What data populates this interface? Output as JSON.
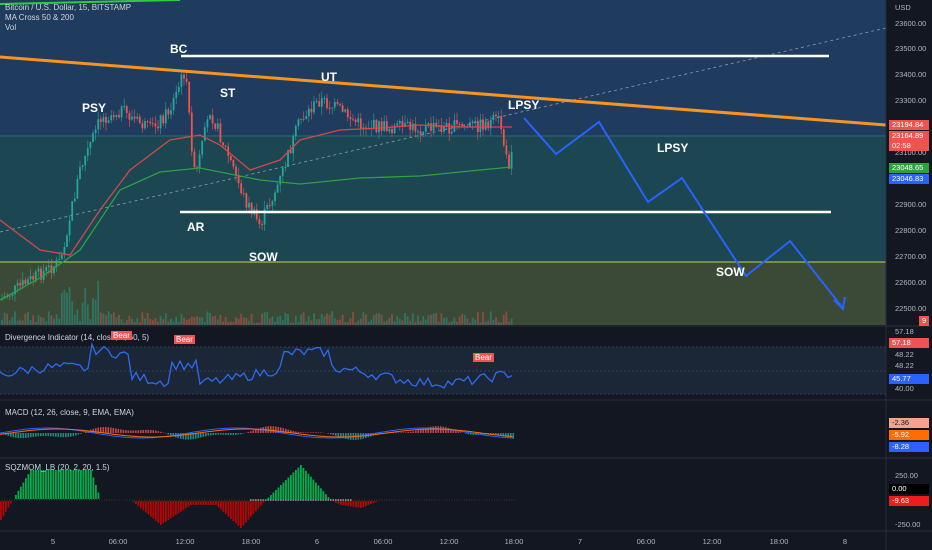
{
  "main_legend": {
    "symbol": "Bitcoin / U.S. Dollar, 15, BITSTAMP",
    "ma": "MA Cross 50 & 200",
    "vol": "Vol"
  },
  "currency": "USD",
  "price_axis": [
    "23600.00",
    "23500.00",
    "23400.00",
    "23300.00",
    "23100.00",
    "22900.00",
    "22800.00",
    "22700.00",
    "22600.00",
    "22500.00"
  ],
  "price_tags": {
    "a": "23194.84",
    "b": "23164.89",
    "c": "02:58",
    "d": "23048.65",
    "e": "23046.83"
  },
  "annotations": {
    "bc": "BC",
    "psy": "PSY",
    "st": "ST",
    "ut": "UT",
    "ar": "AR",
    "sow1": "SOW",
    "lpsy1": "LPSY",
    "lpsy2": "LPSY",
    "sow2": "SOW"
  },
  "divergence": {
    "legend": "Divergence Indicator (14, close, 5, 60, 5)",
    "bear1": "Bear",
    "bear2": "Bear",
    "bear3": "Bear",
    "axis": [
      "57.18",
      "48.22",
      "48.22",
      "40.00"
    ],
    "tags": {
      "a": "57.18",
      "b": "45.77"
    }
  },
  "macd": {
    "legend": "MACD (12, 26, close, 9, EMA, EMA)",
    "tags": {
      "a": "-2.36",
      "b": "-5.92",
      "c": "-8.28"
    }
  },
  "sqz": {
    "legend": "SQZMOM_LB (20, 2, 20, 1.5)",
    "axis": [
      "250.00",
      "-250.00"
    ],
    "tags": {
      "a": "0.00",
      "b": "-9.63"
    }
  },
  "time_axis": [
    "5",
    "06:00",
    "12:00",
    "18:00",
    "6",
    "06:00",
    "12:00",
    "18:00",
    "7",
    "06:00",
    "12:00",
    "18:00",
    "8"
  ],
  "small_tag": "9",
  "colors": {
    "background": "#131722",
    "upper_zone": "#1e3a5c",
    "mid_zone": "#1a4a55",
    "lower_zone": "#3d4a3a",
    "trendline": "#f59323",
    "projection": "#2962ff",
    "bull_candle": "#26a69a",
    "bear_candle": "#ef5350",
    "ma50": "#d14a4a",
    "ma200": "#2ea043"
  }
}
